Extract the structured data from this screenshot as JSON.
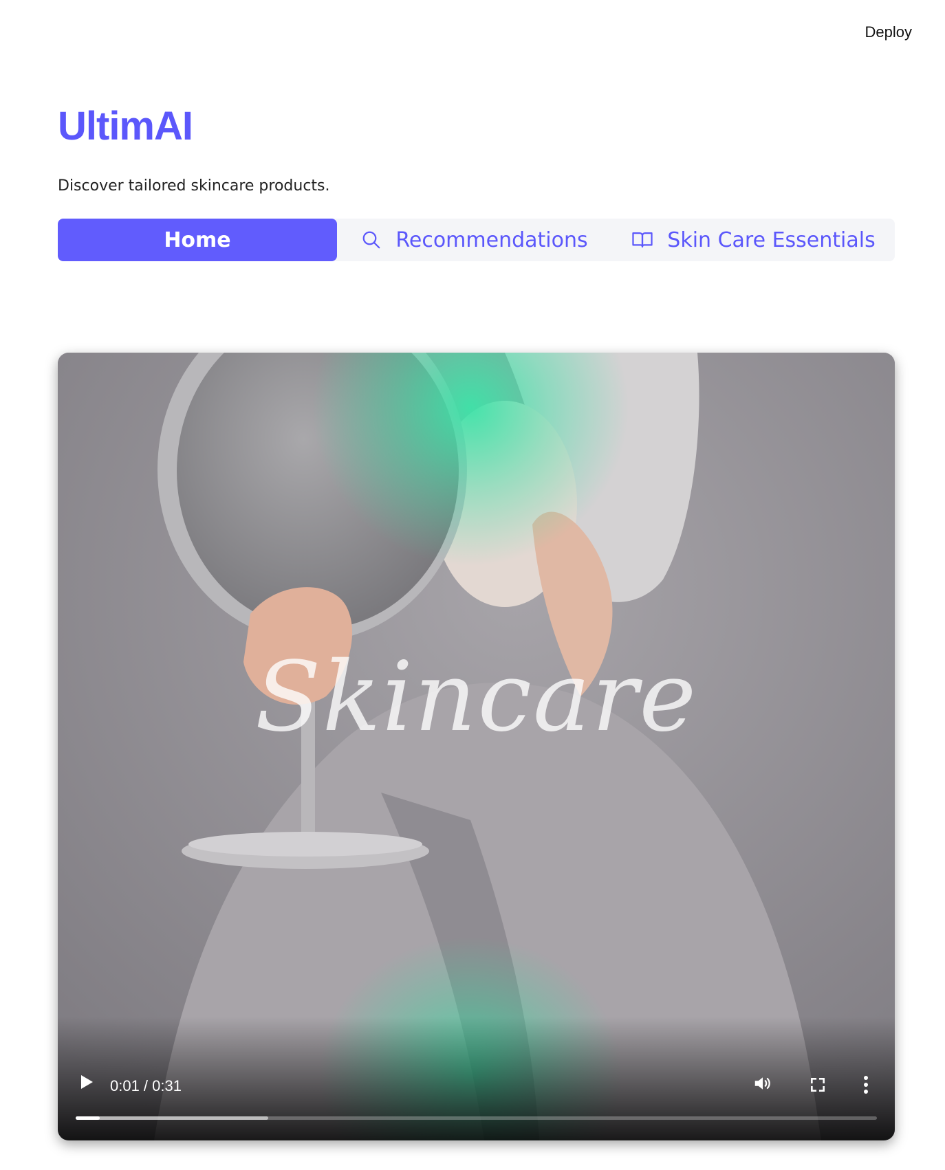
{
  "header": {
    "deploy_label": "Deploy"
  },
  "app": {
    "title": "UltimAI",
    "subtitle": "Discover tailored skincare products."
  },
  "nav": {
    "tabs": [
      {
        "label": "Home",
        "icon": "",
        "active": true
      },
      {
        "label": "Recommendations",
        "icon": "search-icon",
        "active": false
      },
      {
        "label": "Skin Care Essentials",
        "icon": "book-icon",
        "active": false
      }
    ]
  },
  "video": {
    "overlay_text": "Skincare",
    "current_time": "0:01",
    "duration": "0:31",
    "time_display": "0:01 / 0:31",
    "played_fraction": 0.03,
    "buffered_fraction": 0.24,
    "colors": {
      "glow": "#3de3a8",
      "accent": "#5b57fb"
    }
  }
}
